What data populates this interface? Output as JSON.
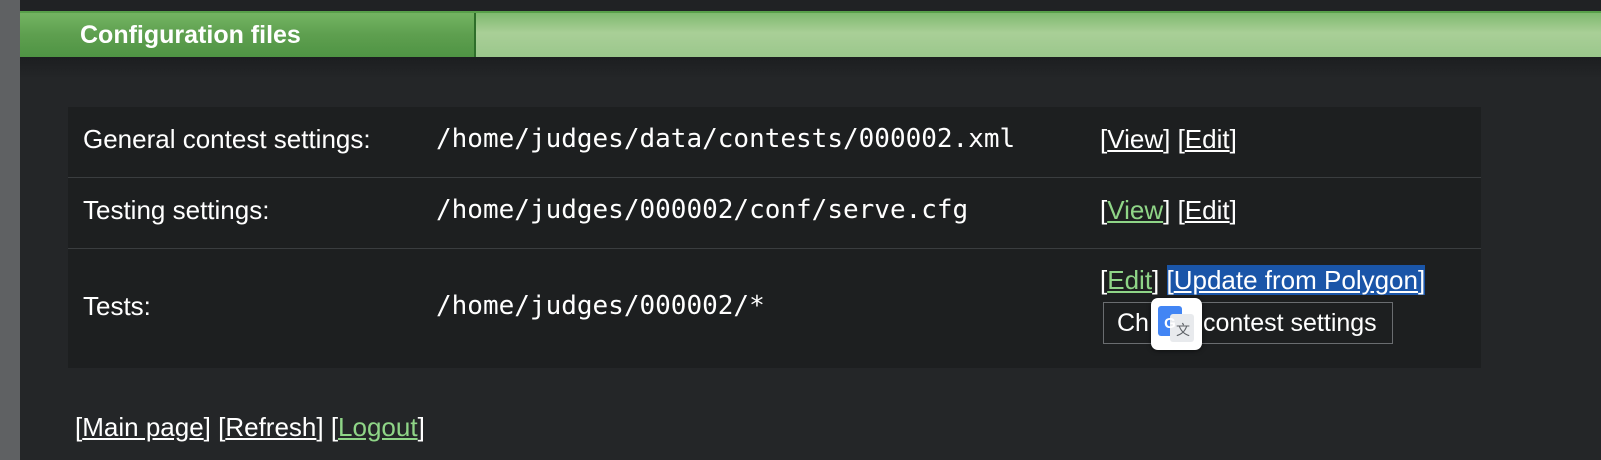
{
  "header": {
    "title": "Configuration files"
  },
  "config_rows": [
    {
      "label": "General contest settings:",
      "path": "/home/judges/data/contests/000002.xml",
      "actions": [
        "View",
        "Edit"
      ]
    },
    {
      "label": "Testing settings:",
      "path": "/home/judges/000002/conf/serve.cfg",
      "actions": [
        "View",
        "Edit"
      ]
    },
    {
      "label": "Tests:",
      "path": "/home/judges/000002/*",
      "actions": [
        "Edit",
        "Update from Polygon"
      ],
      "button_label": "Change contest settings",
      "button_visible_start": "Ch",
      "button_visible_end": "contest settings"
    }
  ],
  "footer": {
    "links": [
      "Main page",
      "Refresh",
      "Logout"
    ]
  },
  "translate_popup": {
    "icon": "google-translate-icon",
    "letter": "G",
    "glyph": "文"
  },
  "colors": {
    "header_green": "#5e9f4f",
    "visited_link": "#8fd587",
    "selection": "#1a55a8"
  }
}
